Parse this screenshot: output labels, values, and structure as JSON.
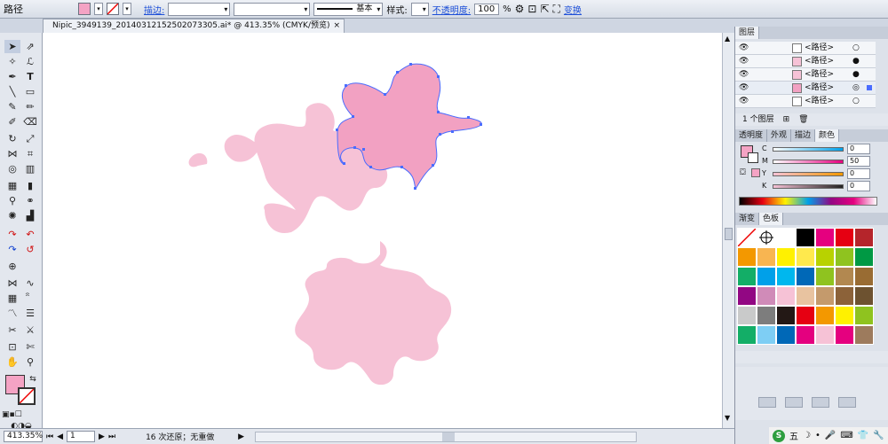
{
  "control_bar": {
    "object_type": "路径",
    "fill_color": "#f4a3c4",
    "stroke_label": "描边:",
    "stroke_weight": "",
    "brush_label": "基本",
    "style_label": "样式:",
    "opacity_label": "不透明度:",
    "opacity_value": "100",
    "percent": "%",
    "transform_label": "变换"
  },
  "document": {
    "tab_title": "Nipic_3949139_20140312152502073305.ai* @ 413.35% (CMYK/预览)",
    "close": "×"
  },
  "colors": {
    "pink_light": "#f6c2d6",
    "pink_selected": "#f2a1c2",
    "selection": "#4a6cff",
    "fill": "#f4a3c4"
  },
  "status": {
    "zoom": "413.35%",
    "page": "1",
    "undo": "16 次还原；无重做"
  },
  "layers_panel": {
    "tab": "图层",
    "items": [
      {
        "name": "<路径>",
        "target": "○"
      },
      {
        "name": "<路径>",
        "target": "●"
      },
      {
        "name": "<路径>",
        "target": "●"
      },
      {
        "name": "<路径>",
        "target": "◎"
      },
      {
        "name": "<路径>",
        "target": "○"
      }
    ],
    "count": "1 个图层"
  },
  "color_panel": {
    "tabs": [
      "透明度",
      "外观",
      "描边",
      "颜色"
    ],
    "channels": [
      {
        "label": "C",
        "value": "0"
      },
      {
        "label": "M",
        "value": "50"
      },
      {
        "label": "Y",
        "value": "0"
      },
      {
        "label": "K",
        "value": "0"
      }
    ]
  },
  "swatches_panel": {
    "tabs": [
      "渐变",
      "色板"
    ],
    "swatches": [
      "#ffffff",
      "#ffffff",
      "#ffffff",
      "#000000",
      "#e5007f",
      "#e60012",
      "#b5252b",
      "#f39800",
      "#f8b551",
      "#fff100",
      "#ffe94d",
      "#b8d200",
      "#8fc31f",
      "#009944",
      "#13ae67",
      "#00a0e9",
      "#00b7ee",
      "#0068b7",
      "#8fc31f",
      "#b28850",
      "#996c33",
      "#920783",
      "#d08bb8",
      "#f6c2d6",
      "#e8c3a0",
      "#c49a6c",
      "#8c6239",
      "#6d5230",
      "#c9caca",
      "#7d7d7d",
      "#231815",
      "#e60012",
      "#f39800",
      "#fff100",
      "#8fc31f",
      "#13ae67",
      "#7ecef4",
      "#0068b7",
      "#e4007f",
      "#f6c2d6",
      "#e5007f",
      "#9d7b5d"
    ]
  },
  "taskbar": {
    "ime": "五",
    "moon": "☽",
    "dot": "•"
  }
}
